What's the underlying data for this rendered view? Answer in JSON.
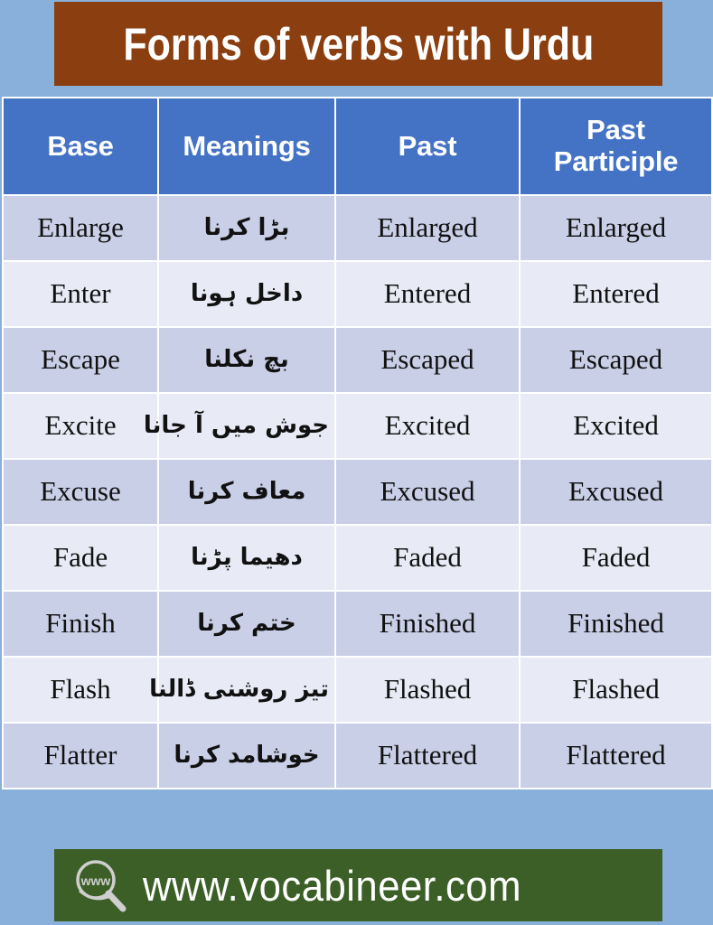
{
  "page": {
    "background_color": "#88b0da"
  },
  "title": {
    "text": "Forms of verbs with Urdu",
    "banner_color": "#8b3e0f",
    "text_color": "#ffffff"
  },
  "table": {
    "header_color": "#4472c4",
    "header_text_color": "#ffffff",
    "row_band_a_color": "#c9cfe7",
    "row_band_b_color": "#e8ebf5",
    "columns": [
      "Base",
      "Meanings",
      "Past",
      "Past\nParticiple"
    ],
    "headers": {
      "base": "Base",
      "meanings": "Meanings",
      "past": "Past",
      "past_participle_line1": "Past",
      "past_participle_line2": "Participle"
    },
    "rows": [
      {
        "base": "Enlarge",
        "meaning": "بڑا کرنا",
        "past": "Enlarged",
        "participle": "Enlarged"
      },
      {
        "base": "Enter",
        "meaning": "داخل ہونا",
        "past": "Entered",
        "participle": "Entered"
      },
      {
        "base": "Escape",
        "meaning": "بچ نکلنا",
        "past": "Escaped",
        "participle": "Escaped"
      },
      {
        "base": "Excite",
        "meaning": "جوش میں آ جانا",
        "past": "Excited",
        "participle": "Excited"
      },
      {
        "base": "Excuse",
        "meaning": "معاف کرنا",
        "past": "Excused",
        "participle": "Excused"
      },
      {
        "base": "Fade",
        "meaning": "دھیما پڑنا",
        "past": "Faded",
        "participle": "Faded"
      },
      {
        "base": "Finish",
        "meaning": "ختم کرنا",
        "past": "Finished",
        "participle": "Finished"
      },
      {
        "base": "Flash",
        "meaning": "تیز روشنی ڈالنا",
        "past": "Flashed",
        "participle": "Flashed"
      },
      {
        "base": "Flatter",
        "meaning": "خوشامد کرنا",
        "past": "Flattered",
        "participle": "Flattered"
      }
    ]
  },
  "footer": {
    "url": "www.vocabineer.com",
    "icon": "magnifier-www-icon",
    "icon_label": "www",
    "bar_color": "#3b5f26",
    "text_color": "#ffffff"
  }
}
